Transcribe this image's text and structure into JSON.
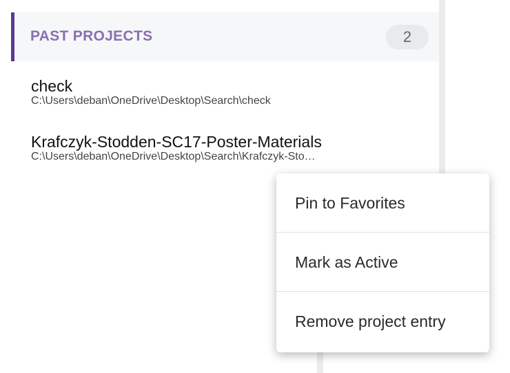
{
  "past_projects": {
    "title": "PAST PROJECTS",
    "count": "2",
    "items": [
      {
        "name": "check",
        "path": "C:\\Users\\deban\\OneDrive\\Desktop\\Search\\check"
      },
      {
        "name": "Krafczyk-Stodden-SC17-Poster-Materials",
        "path": "C:\\Users\\deban\\OneDrive\\Desktop\\Search\\Krafczyk-Sto…"
      }
    ]
  },
  "context_menu": {
    "items": [
      {
        "label": "Pin to Favorites"
      },
      {
        "label": "Mark as Active"
      },
      {
        "label": "Remove project entry"
      }
    ]
  },
  "colors": {
    "accent": "#5b3a91",
    "title": "#8a6fb0",
    "header_bg": "#f6f7f9",
    "badge_bg": "#e8eaed"
  }
}
